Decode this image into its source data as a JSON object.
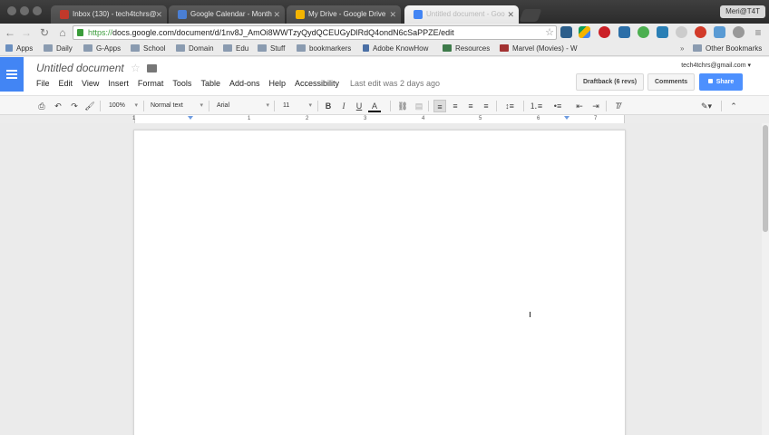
{
  "browser": {
    "tabs": [
      {
        "label": "Inbox (130) - tech4tchrs@",
        "favicon_color": "#c0392b",
        "active": false
      },
      {
        "label": "Google Calendar - Month",
        "favicon_color": "#4a7fd4",
        "active": false
      },
      {
        "label": "My Drive - Google Drive",
        "favicon_color": "#f4b400",
        "active": false
      },
      {
        "label": "Untitled document - Goo",
        "favicon_color": "#4285f4",
        "active": true
      }
    ],
    "profile_label": "Meri@T4T",
    "url_scheme": "https://",
    "url_rest": "docs.google.com/document/d/1nv8J_AmOi8WWTzyQydQCEUGyDlRdQ4ondN6cSaPPZE/edit",
    "bookmarks": [
      "Apps",
      "Daily",
      "G-Apps",
      "School",
      "Domain",
      "Edu",
      "Stuff",
      "bookmarkers",
      "Adobe KnowHow",
      "Resources",
      "Marvel (Movies) - W"
    ],
    "other_bookmarks": "Other Bookmarks",
    "overflow_label": "»"
  },
  "docs": {
    "title": "Untitled document",
    "menu": [
      "File",
      "Edit",
      "View",
      "Insert",
      "Format",
      "Tools",
      "Table",
      "Add-ons",
      "Help",
      "Accessibility"
    ],
    "last_edit": "Last edit was 2 days ago",
    "account": "tech4tchrs@gmail.com",
    "draftback_label": "Draftback (6 revs)",
    "comments_label": "Comments",
    "share_label": "Share",
    "accent_color": "#4d90fe"
  },
  "toolbar": {
    "zoom": "100%",
    "style": "Normal text",
    "font": "Arial",
    "size": "11",
    "bold": "B",
    "italic": "I",
    "underline": "U",
    "text_color": "A"
  },
  "ruler": {
    "numbers": [
      "1",
      "1",
      "2",
      "3",
      "4",
      "5",
      "6",
      "7"
    ]
  }
}
